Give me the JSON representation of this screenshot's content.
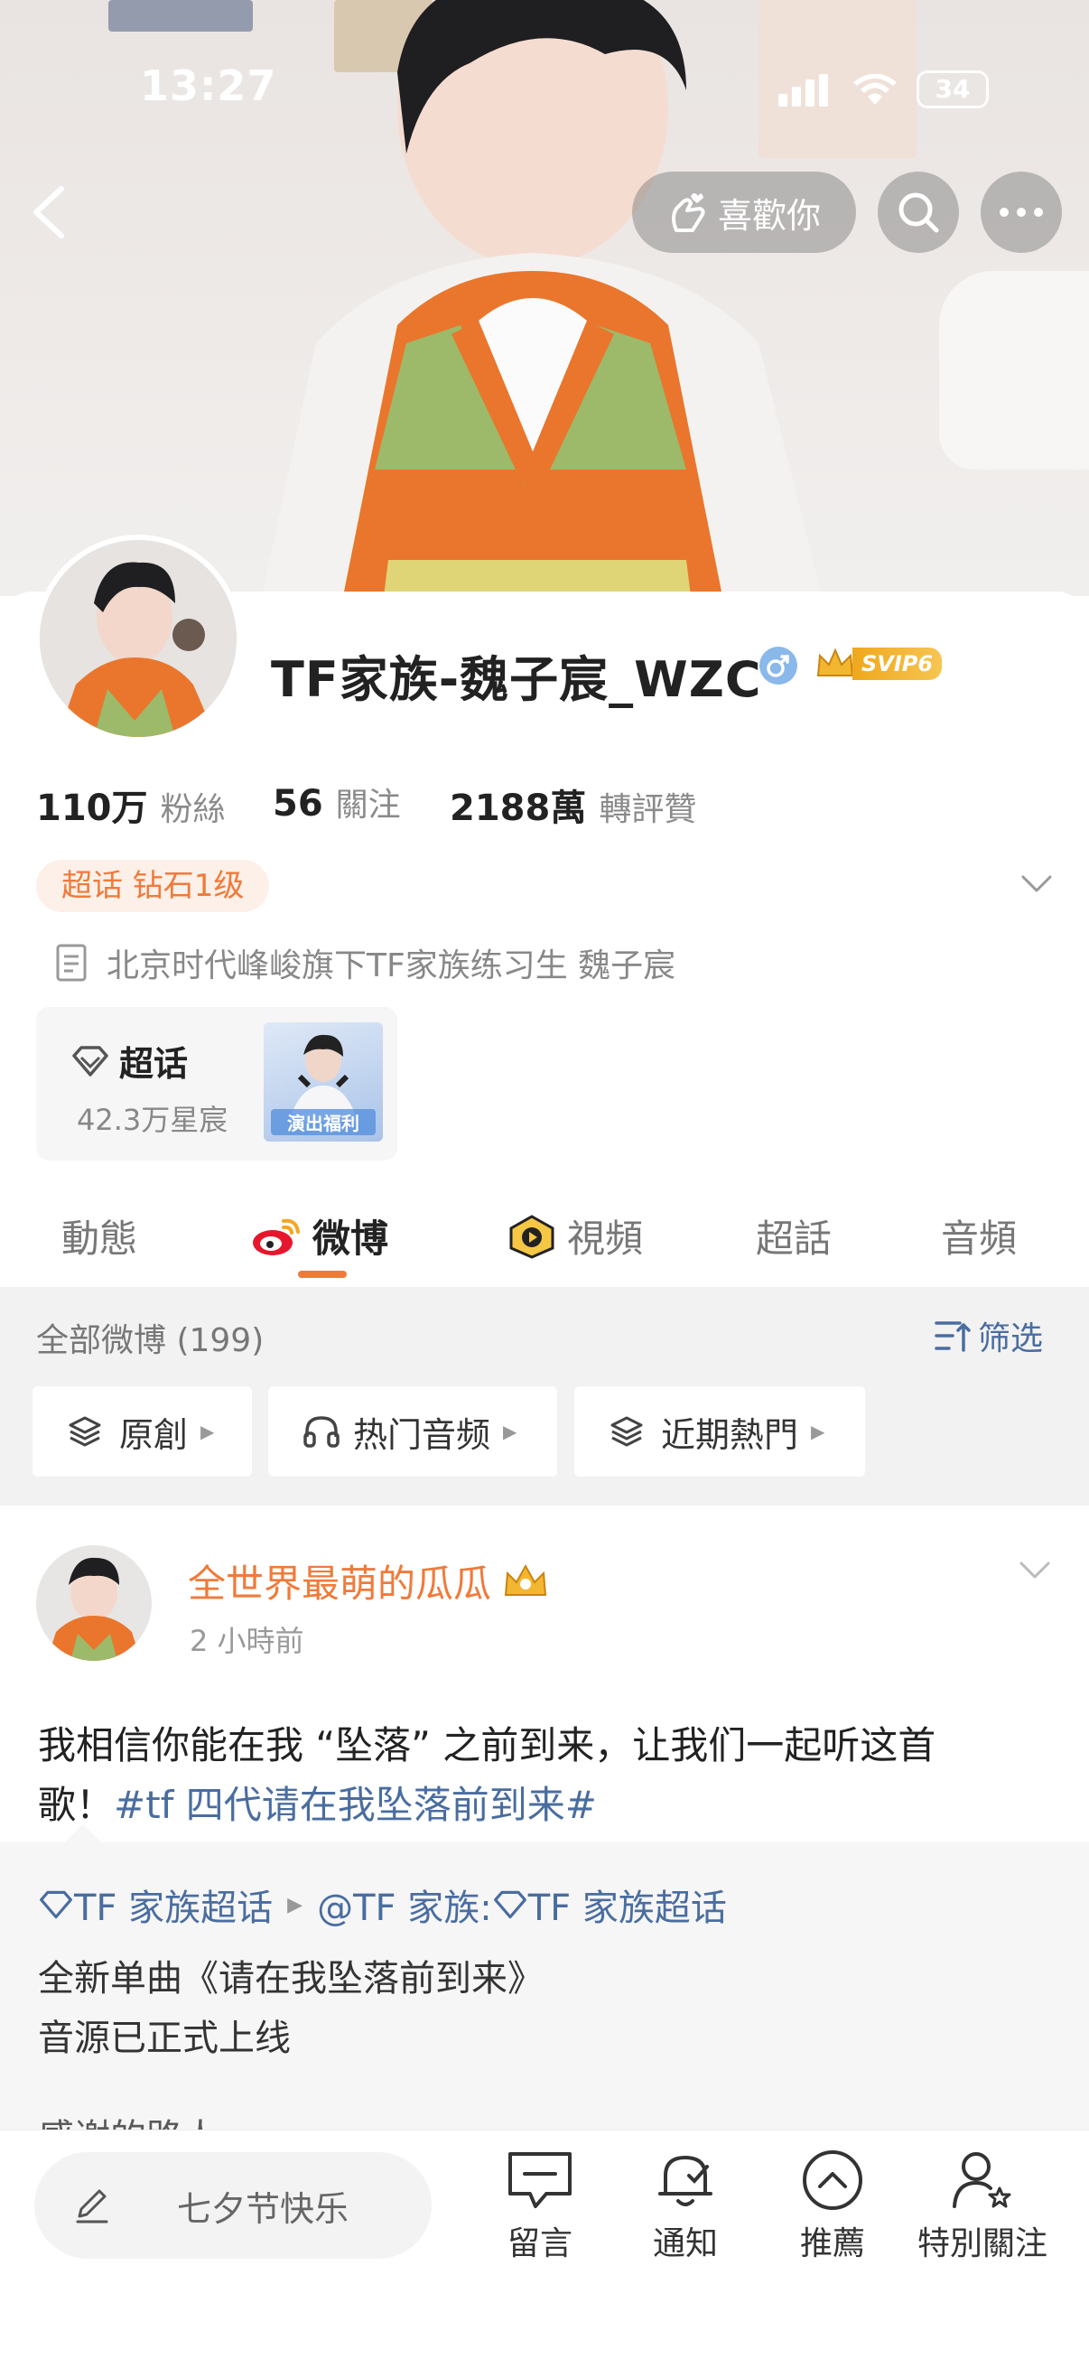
{
  "status_bar": {
    "time": "13:27",
    "battery": "34"
  },
  "header": {
    "like_label": "喜歡你"
  },
  "profile": {
    "nickname": "TF家族-魏子宸_WZC",
    "svip_badge": "SVIP6",
    "stats": [
      {
        "value": "110万",
        "label": "粉絲"
      },
      {
        "value": "56",
        "label": "關注"
      },
      {
        "value": "2188萬",
        "label": "轉評贊"
      }
    ],
    "tag": "超话 钻石1级",
    "bio": "北京时代峰峻旗下TF家族练习生 魏子宸",
    "supertopic": {
      "title": "超话",
      "subtitle": "42.3万星宸",
      "thumb_text": "演出福利"
    }
  },
  "tabs": [
    {
      "label": "動態"
    },
    {
      "label": "微博"
    },
    {
      "label": "視頻"
    },
    {
      "label": "超話"
    },
    {
      "label": "音頻"
    }
  ],
  "filter": {
    "all_weibo": "全部微博 (199)",
    "filter_label": "筛选",
    "chips": [
      {
        "label": "原創"
      },
      {
        "label": "热门音频"
      },
      {
        "label": "近期熱門"
      }
    ]
  },
  "post": {
    "author": "全世界最萌的瓜瓜",
    "time": "2 小時前",
    "text_line1": "我相信你能在我 “坠落” 之前到来，让我们一起听这首",
    "text_line2_prefix": "歌！",
    "hashtag": "#tf 四代请在我坠落前到来#",
    "quote": {
      "source1": "TF 家族超话",
      "author": "@TF 家族:",
      "source2": "TF 家族超话",
      "line1": "全新单曲《请在我坠落前到来》",
      "line2": "音源已正式上线",
      "line3_partial": "感谢的路人"
    }
  },
  "bottom_bar": {
    "compose_placeholder": "七夕节快乐",
    "items": [
      {
        "label": "留言",
        "icon": "comment-icon"
      },
      {
        "label": "通知",
        "icon": "bell-icon"
      },
      {
        "label": "推薦",
        "icon": "chevron-up-circle-icon"
      },
      {
        "label": "特別關注",
        "icon": "user-star-icon"
      }
    ]
  },
  "colors": {
    "accent": "#f07a3a",
    "link": "#4a6da0",
    "svip_gold": "#e8a21a"
  }
}
